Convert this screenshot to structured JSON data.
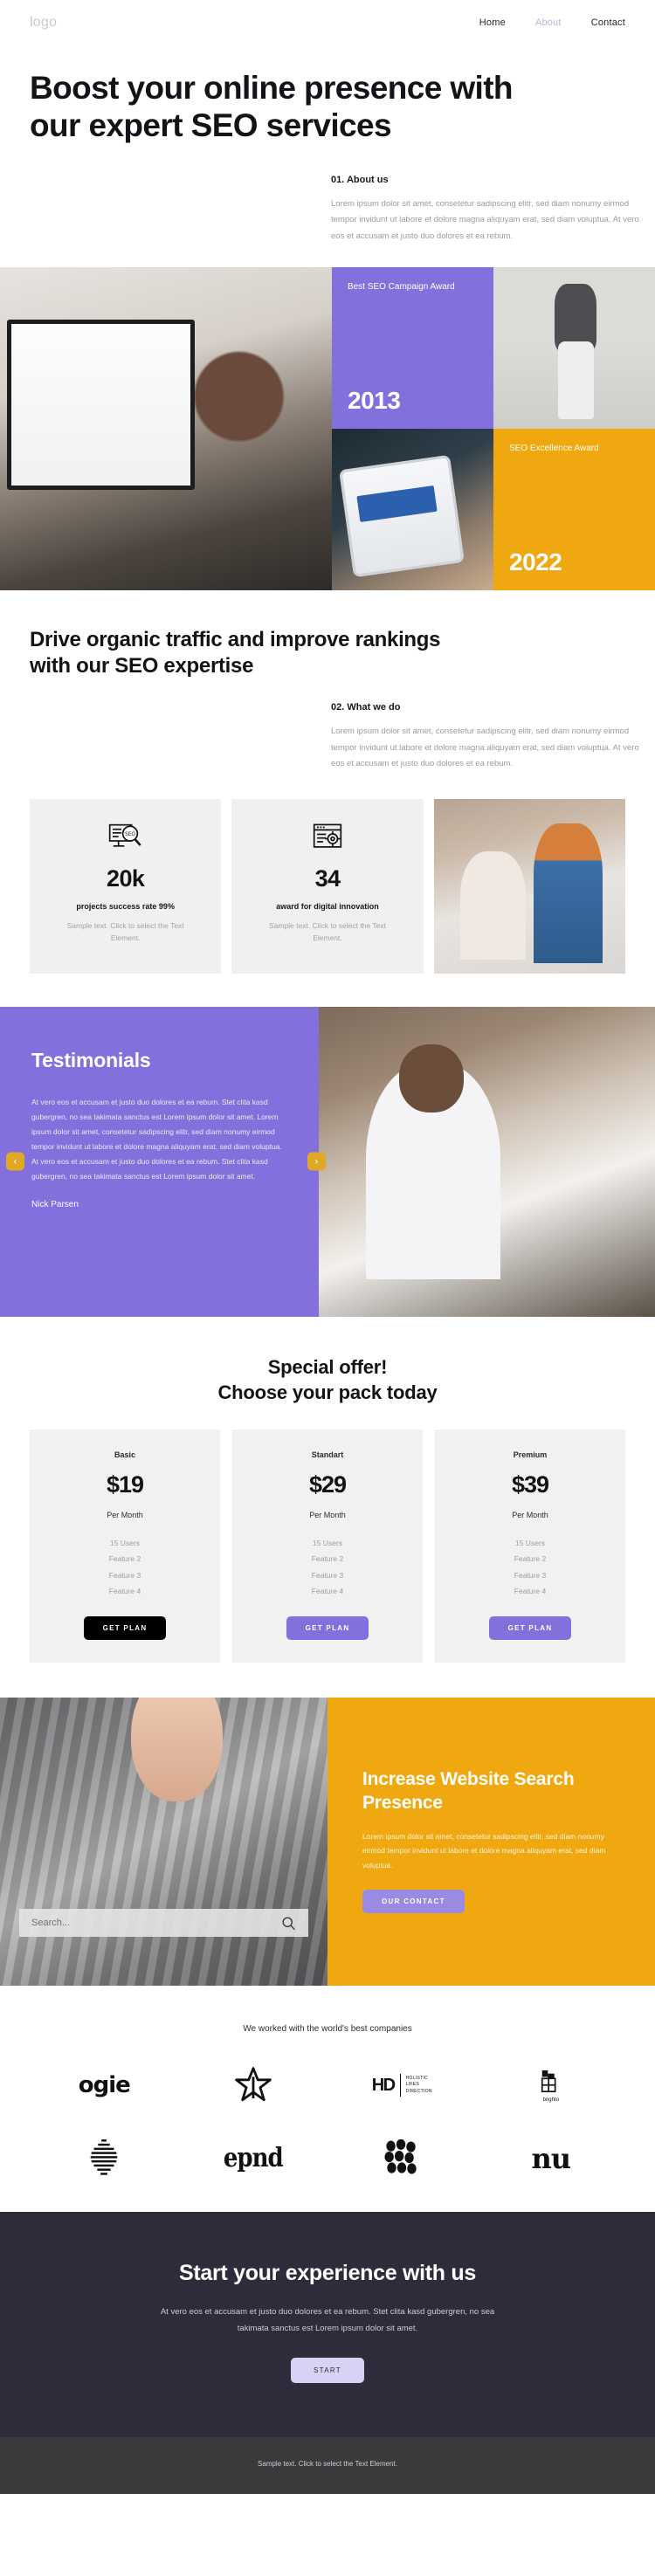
{
  "header": {
    "logo": "logo",
    "nav": [
      {
        "label": "Home",
        "muted": false
      },
      {
        "label": "About",
        "muted": true
      },
      {
        "label": "Contact",
        "muted": false
      }
    ]
  },
  "hero": {
    "heading": "Boost your online presence with our expert SEO services",
    "about_kicker": "01. About us",
    "about_body": "Lorem ipsum dolor sit amet, consetetur sadipscing elitr, sed diam nonumy eirmod tempor invidunt ut labore et dolore magna aliquyam erat, sed diam voluptua. At vero eos et accusam et justo duo dolores et ea rebum."
  },
  "awards": {
    "card1": {
      "title": "Best SEO Campaign Award",
      "year": "2013",
      "color": "#8470dd"
    },
    "card2": {
      "title": "SEO Excellence Award",
      "year": "2022",
      "color": "#efa80f"
    },
    "photo_big": "woman-pointing-at-analytics-monitor-photo",
    "photo_model": "woman-in-blazer-standing-photo",
    "photo_tablet": "hands-holding-tablet-with-dashboard-photo"
  },
  "section2": {
    "heading": "Drive organic traffic and improve rankings with our SEO expertise",
    "kicker": "02. What we do",
    "body": "Lorem ipsum dolor sit amet, consetetur sadipscing elitr, sed diam nonumy eirmod tempor invidunt ut labore et dolore magna aliquyam erat, sed diam voluptua. At vero eos et accusam et justo duo dolores et ea rebum."
  },
  "stats": [
    {
      "icon": "seo-monitor-magnifier-icon",
      "number": "20k",
      "label": "projects success rate 99%",
      "desc": "Sample text. Click to select the Text Element."
    },
    {
      "icon": "browser-gear-icon",
      "number": "34",
      "label": "award for digital innovation",
      "desc": "Sample text. Click to select the Text Element."
    }
  ],
  "stats_photo": "two-colleagues-at-laptop-photo",
  "testimonials": {
    "heading": "Testimonials",
    "quote": "At vero eos et accusam et justo duo dolores et ea rebum. Stet clita kasd gubergren, no sea takimata sanctus est Lorem ipsum dolor sit amet. Lorem ipsum dolor sit amet, consetetur sadipscing elitr, sed diam nonumy eirmod tempor invidunt ut labore et dolore magna aliquyam erat, sed diam voluptua. At vero eos et accusam et justo duo dolores et ea rebum. Stet clita kasd gubergren, no sea takimata sanctus est Lorem ipsum dolor sit amet.",
    "author": "Nick Parsen",
    "prev": "‹",
    "next": "›",
    "photo": "man-working-at-desk-photo",
    "bg_color": "#8470dd",
    "arrow_color": "#e0a925"
  },
  "pricing": {
    "heading_line1": "Special offer!",
    "heading_line2": "Choose your pack today",
    "plans": [
      {
        "name": "Basic",
        "price": "$19",
        "per": "Per Month",
        "features": [
          "15 Users",
          "Feature 2",
          "Feature 3",
          "Feature 4"
        ],
        "cta": "GET PLAN",
        "cta_style": "dark"
      },
      {
        "name": "Standart",
        "price": "$29",
        "per": "Per Month",
        "features": [
          "15 Users",
          "Feature 2",
          "Feature 3",
          "Feature 4"
        ],
        "cta": "GET PLAN",
        "cta_style": "purple"
      },
      {
        "name": "Premium",
        "price": "$39",
        "per": "Per Month",
        "features": [
          "15 Users",
          "Feature 2",
          "Feature 3",
          "Feature 4"
        ],
        "cta": "GET PLAN",
        "cta_style": "purple"
      }
    ]
  },
  "presence": {
    "photo": "fingers-typing-on-keyboard-photo",
    "search_placeholder": "Search...",
    "search_value": "",
    "search_icon": "search-icon",
    "heading": "Increase Website Search Presence",
    "body": "Lorem ipsum dolor sit amet, consetetur sadipscing elitr, sed diam nonumy eirmod tempor invidunt ut labore et dolore magna aliquyam erat, sed diam voluptua.",
    "cta": "OUR CONTACT",
    "bg_color": "#efa80f",
    "cta_color": "#9a8ae2"
  },
  "partners": {
    "title": "We worked with the world's best companies",
    "logos": [
      {
        "name": "ogie",
        "type": "word",
        "text": "ogie"
      },
      {
        "name": "flower-star-logo",
        "type": "mark"
      },
      {
        "name": "hd-holistic-lifes-direction",
        "type": "hd",
        "mark": "HD",
        "line1": "HOLISTIC",
        "line2": "LIFES",
        "line3": "DIRECTION"
      },
      {
        "name": "brighto",
        "type": "brighto",
        "text": "brighto"
      },
      {
        "name": "striped-circle-logo",
        "type": "stripes"
      },
      {
        "name": "epnd",
        "type": "word",
        "text": "epnd"
      },
      {
        "name": "dots-cluster-logo",
        "type": "dots"
      },
      {
        "name": "nu",
        "type": "word",
        "text": "nu"
      }
    ]
  },
  "cta": {
    "heading": "Start your experience with us",
    "body": "At vero eos et accusam et justo duo dolores et ea rebum. Stet clita kasd gubergren, no sea takimata sanctus est Lorem ipsum dolor sit amet.",
    "button": "START",
    "bg_color": "#2e2b3a",
    "button_color": "#d8d2f4"
  },
  "footer": {
    "text": "Sample text. Click to select the Text Element."
  }
}
